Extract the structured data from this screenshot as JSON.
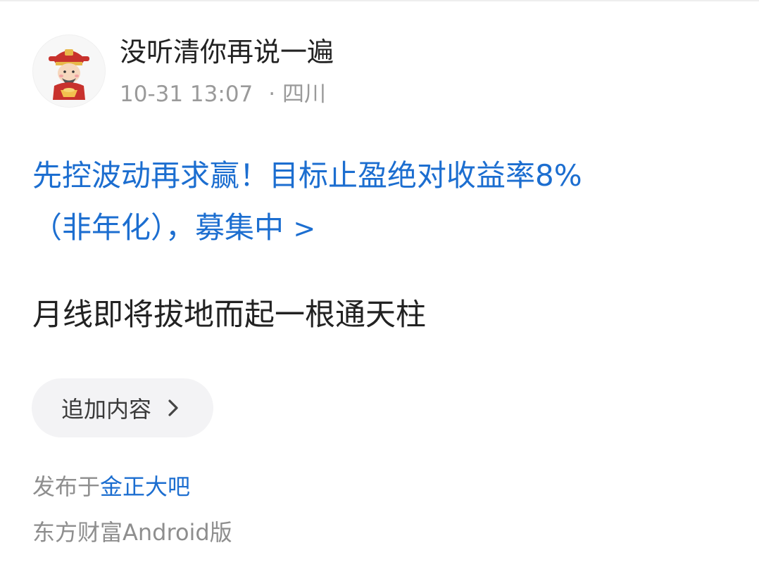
{
  "post": {
    "author": {
      "name": "没听清你再说一遍",
      "avatar_icon": "caishen-avatar-icon"
    },
    "meta": {
      "time": "10-31 13:07",
      "location": "· 四川"
    },
    "promo": {
      "text_line1": "先控波动再求赢！目标止盈绝对收益率8%",
      "text_line2": "（非年化），募集中",
      "chevron": ">",
      "color": "#1c6ed0"
    },
    "body": "月线即将拔地而起一根通天柱",
    "add_content": {
      "label": "追加内容"
    },
    "published": {
      "prefix": "发布于",
      "bar_name": "金正大吧"
    },
    "platform": "东方财富Android版"
  }
}
